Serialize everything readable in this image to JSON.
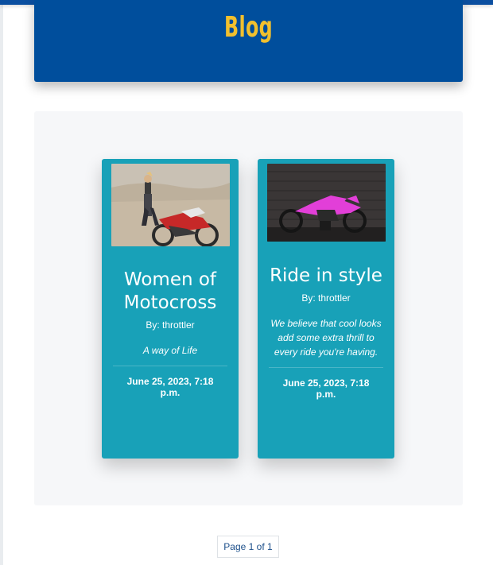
{
  "header": {
    "title": "Blog"
  },
  "posts": [
    {
      "title": "Women of Motocross",
      "author": "By: throttler",
      "summary": "A way of Life",
      "date": "June 25, 2023, 7:18 p.m."
    },
    {
      "title": "Ride in style",
      "author": "By: throttler",
      "summary": "We believe that cool looks add some extra thrill to every ride you're having.",
      "date": "June 25, 2023, 7:18 p.m."
    }
  ],
  "pagination": {
    "label": "Page 1 of 1"
  },
  "colors": {
    "header_bg": "#004e9c",
    "title_accent": "#f2c02e",
    "card_bg": "#18a1b8",
    "panel_bg": "#f6f7f9"
  }
}
